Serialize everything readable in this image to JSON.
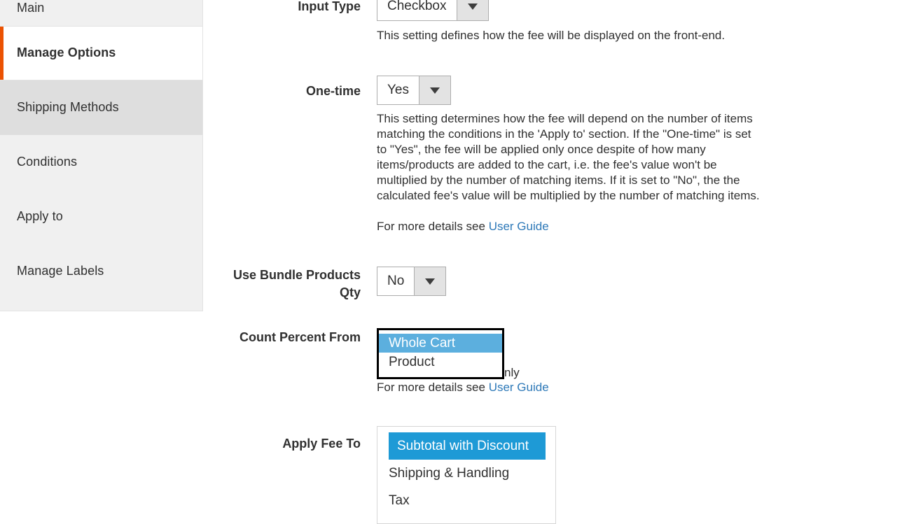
{
  "sidebar": {
    "items": [
      {
        "label": "Main",
        "state": "clipped"
      },
      {
        "label": "Manage Options",
        "state": "active"
      },
      {
        "label": "Shipping Methods",
        "state": "hover"
      },
      {
        "label": "Conditions",
        "state": "normal"
      },
      {
        "label": "Apply to",
        "state": "normal"
      },
      {
        "label": "Manage Labels",
        "state": "normal"
      }
    ],
    "active_marker_color": "#eb5202"
  },
  "form": {
    "input_type": {
      "label": "Input Type",
      "value": "Checkbox",
      "note": "This setting defines how the fee will be displayed on the front-end."
    },
    "one_time": {
      "label": "One-time",
      "value": "Yes",
      "note": "This setting determines how the fee will depend on the number of items matching the conditions in the 'Apply to' section. If the \"One-time\" is set to \"Yes\", the fee will be applied only once despite of how many items/products are added to the cart, i.e. the fee's value won't be multiplied by the number of matching items. If it is set to \"No\", the the calculated fee's value will be multiplied by the number of matching items.",
      "note_more": "For more details see ",
      "note_link": "User Guide"
    },
    "use_bundle_products_qty": {
      "label": "Use Bundle Products Qty",
      "value": "No"
    },
    "count_percent_from": {
      "label": "Count Percent From",
      "value": "Whole Cart",
      "options": [
        "Whole Cart",
        "Product"
      ],
      "obscured_note_tail": "nly",
      "note_more": "For more details see ",
      "note_link": "User Guide",
      "highlight_color": "#5cafde"
    },
    "apply_fee_to": {
      "label": "Apply Fee To",
      "options": [
        "Subtotal with Discount",
        "Shipping & Handling",
        "Tax"
      ],
      "selected": "Subtotal with Discount",
      "highlight_color": "#1e9ad6"
    }
  }
}
